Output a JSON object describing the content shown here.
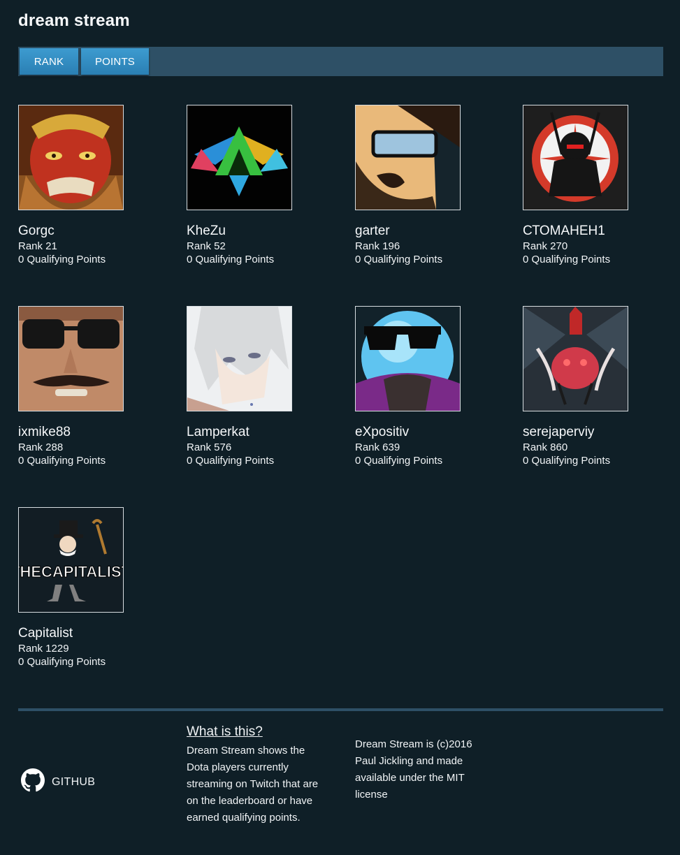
{
  "app": {
    "title": "dream stream"
  },
  "tabs": [
    {
      "label": "RANK"
    },
    {
      "label": "POINTS"
    }
  ],
  "players": [
    {
      "name": "Gorgc",
      "rank": "Rank 21",
      "points": "0 Qualifying Points",
      "avatar": "red-monkey-king-avatar"
    },
    {
      "name": "KheZu",
      "rank": "Rank 52",
      "points": "0 Qualifying Points",
      "avatar": "triforce-crest-avatar"
    },
    {
      "name": "garter",
      "rank": "Rank 196",
      "points": "0 Qualifying Points",
      "avatar": "bearded-glasses-avatar"
    },
    {
      "name": "СТОМАНЕН1",
      "rank": "Rank 270",
      "points": "0 Qualifying Points",
      "avatar": "ninja-emblem-avatar"
    },
    {
      "name": "ixmike88",
      "rank": "Rank 288",
      "points": "0 Qualifying Points",
      "avatar": "sunglasses-face-avatar"
    },
    {
      "name": "Lamperkat",
      "rank": "Rank 576",
      "points": "0 Qualifying Points",
      "avatar": "anime-character-avatar"
    },
    {
      "name": "eXpositiv",
      "rank": "Rank 639",
      "points": "0 Qualifying Points",
      "avatar": "cool-orb-avatar"
    },
    {
      "name": "serejaperviy",
      "rank": "Rank 860",
      "points": "0 Qualifying Points",
      "avatar": "spider-creature-avatar"
    },
    {
      "name": "Capitalist",
      "rank": "Rank 1229",
      "points": "0 Qualifying Points",
      "avatar": "the-capitalist-avatar",
      "logo_text": "THECAPITALIST"
    }
  ],
  "footer": {
    "github_label": "GITHUB",
    "about_title": "What is this?",
    "about_text": "Dream Stream shows the Dota players currently streaming on Twitch that are on the leaderboard or have earned qualifying points.",
    "copyright": "Dream Stream is (c)2016 Paul Jickling and made available under the MIT license"
  },
  "colors": {
    "background": "#0f1f27",
    "tabbar": "#2e5066",
    "tab_active": "#3b97cc",
    "text": "#f1f4f6"
  }
}
